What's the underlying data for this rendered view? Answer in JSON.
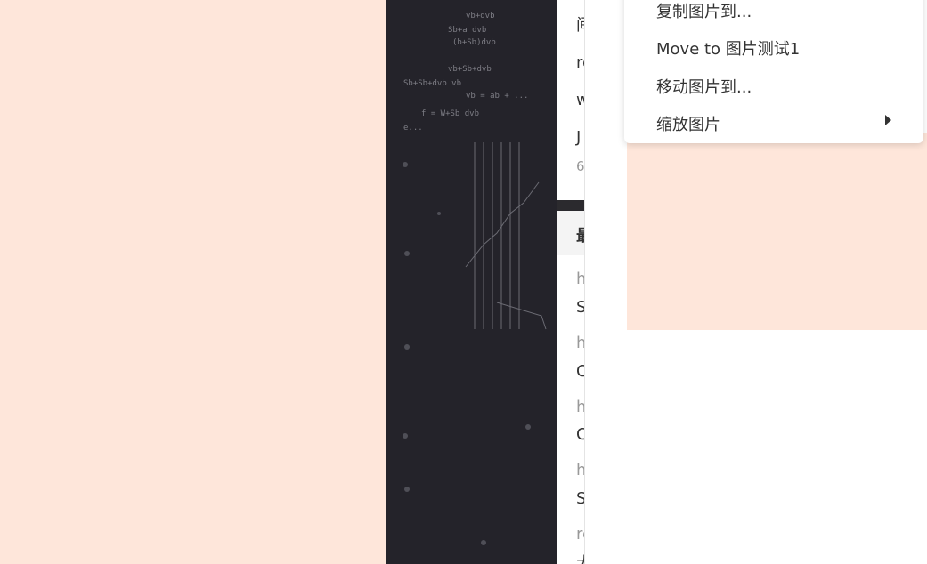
{
  "context_menu": {
    "items": [
      {
        "label": "复制图片到..."
      },
      {
        "label": "Move to 图片测试1"
      },
      {
        "label": "移动图片到..."
      },
      {
        "label": "缩放图片",
        "has_submenu": true
      }
    ]
  },
  "info_card": {
    "rows": [
      "间",
      "re",
      "w",
      "J",
      "6"
    ]
  },
  "recent_card": {
    "header": "最",
    "items": [
      {
        "url": "h",
        "title": "S"
      },
      {
        "url": "h",
        "title": "C"
      },
      {
        "url": "h",
        "title": "C"
      },
      {
        "url": "h",
        "title": "S"
      },
      {
        "url": "re",
        "title": "大"
      }
    ]
  },
  "colors": {
    "background": "#fee6da",
    "board": "#24232a",
    "panel": "#ffffff"
  }
}
